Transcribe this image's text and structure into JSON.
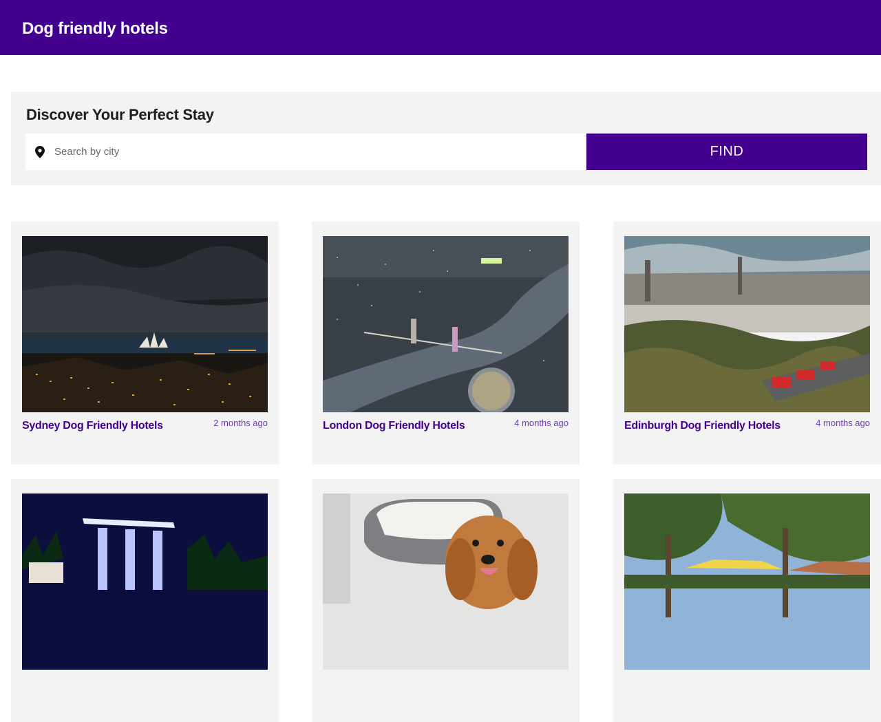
{
  "header": {
    "title": "Dog friendly hotels"
  },
  "search": {
    "heading": "Discover Your Perfect Stay",
    "placeholder": "Search by city",
    "value": "",
    "button_label": "FIND",
    "icon": "map-pin-icon"
  },
  "cards": [
    {
      "title": "Sydney Dog Friendly Hotels",
      "time": "2 months ago",
      "image": "sydney-night-skyline"
    },
    {
      "title": "London Dog Friendly Hotels",
      "time": "4 months ago",
      "image": "london-tower-bridge-aerial"
    },
    {
      "title": "Edinburgh Dog Friendly Hotels",
      "time": "4 months ago",
      "image": "edinburgh-city-view"
    },
    {
      "title": "",
      "time": "",
      "image": "singapore-marina-bay-night"
    },
    {
      "title": "",
      "time": "",
      "image": "dog-with-bed"
    },
    {
      "title": "",
      "time": "",
      "image": "garden-umbrellas-trees"
    }
  ],
  "colors": {
    "brand": "#44008f",
    "panel": "#f3f3f3",
    "meta": "#6a3ea8"
  }
}
